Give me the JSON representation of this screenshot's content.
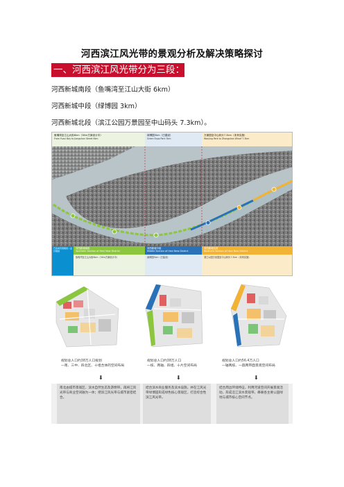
{
  "title": "河西滨江风光带的景观分析及解决策略探讨",
  "section1": "一、河西滨江风光带分为三段：",
  "paragraphs": [
    "河西新城南段（鱼嘴湾至江山大街 6km）",
    "河西新城中段（绿博园 3km）",
    "河西新城北段（滨江公园万景园至中山码头 7.3km）。"
  ],
  "figure1": {
    "headers": [
      {
        "title": "鱼嘴湾至江山大街6km（3Km方案设计中）",
        "sub": "From Yuzui Bay to Jiangshan Street 6km"
      },
      {
        "title": "绿博园3km（已建设）",
        "sub": "Green Expo Park 3km"
      },
      {
        "title": "万景园至中山码头7.3km（未来实施）",
        "sub": "Wanjing Park to Zhongshan Wharf 7.3km"
      }
    ],
    "side_label": "已完成景观规划 / 设计规划",
    "bands": [
      {
        "name": "河西新城南段",
        "en": "Southern Section of Hexi New District",
        "detail": "鱼嘴湾至江山大街6km（3Km方案设计中）",
        "color": "#8cc63f"
      },
      {
        "name": "河西新城中段",
        "en": "Middle Section of Hexi New District",
        "detail": "绿博园3km（已建设）",
        "color": "#2a72b8"
      },
      {
        "name": "河西新城北段",
        "en": "Northern Section of Hexi New District",
        "detail": "滨江公园万景园至中山码头7.3km（未来实施）",
        "color": "#f2b233"
      }
    ],
    "map_labels": [
      "1",
      "2",
      "3",
      "4",
      "5",
      "6"
    ]
  },
  "figure2": {
    "captions": [
      "规划总人口约38万人口规划\n一南、三中、四北区、十组合体的空间布局",
      "规划总人口约38万人口\n一核、两轴、四组、十片空间布局",
      "规划总人口约56.4万人口\n一轴两核、一圆两带面景观空间布局"
    ],
    "descriptions": [
      "南北由城市景观区、滨水自然生态及游憩带，再将江风光带与商业空间融为一体；把滨江风光带与城市紧密结合。",
      "结合滨水商业服务及滨水设施，并在江风光带绿博园形成绿色核心景观区，打造综合性滨江风光带。",
      "结合周边环境特征，利用河道空间开展景观活动，形成沿江滨水景观带，串联各主要公园绿地与城市核心空间节点。"
    ]
  },
  "colors": {
    "accent": "#c8102e",
    "green": "#8cc63f",
    "blue": "#2a72b8",
    "orange": "#f2b233"
  }
}
